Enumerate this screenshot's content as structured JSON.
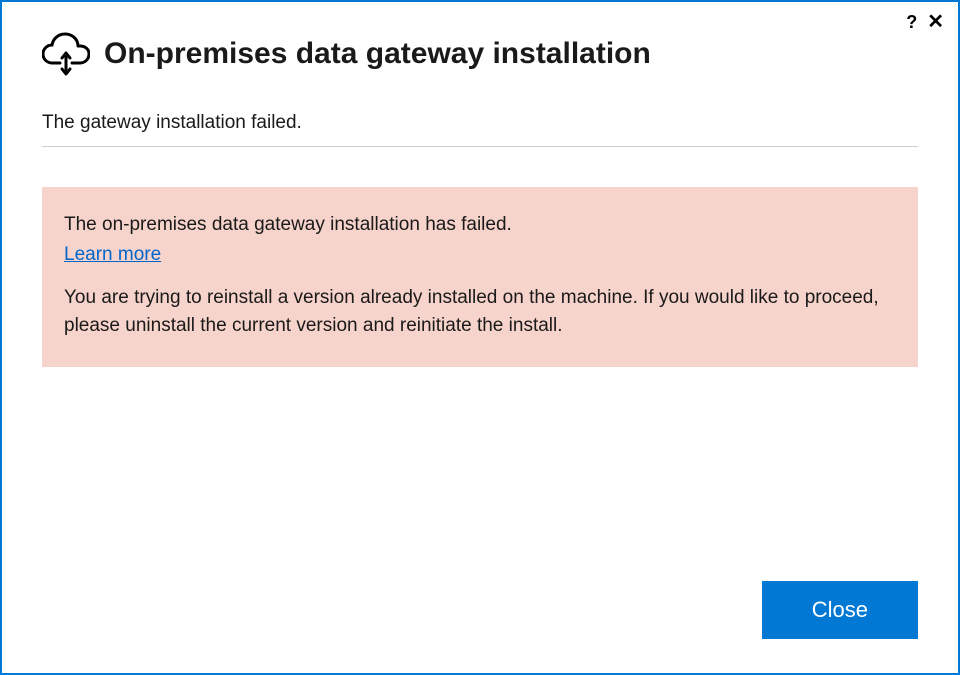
{
  "header": {
    "title": "On-premises data gateway installation"
  },
  "status": {
    "message": "The gateway installation failed."
  },
  "error": {
    "title": "The on-premises data gateway installation has failed.",
    "learn_more_label": "Learn more",
    "detail": "You are trying to reinstall a version already installed on the machine. If you would like to proceed, please uninstall the current version and reinitiate the install."
  },
  "footer": {
    "close_label": "Close"
  },
  "titlebar": {
    "help_glyph": "?",
    "close_glyph": "✕"
  }
}
